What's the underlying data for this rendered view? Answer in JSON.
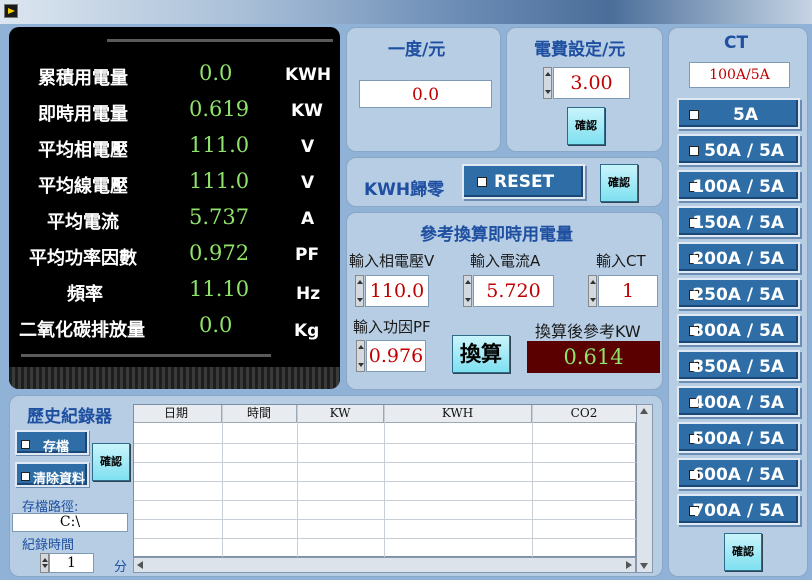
{
  "meter": {
    "rows": [
      {
        "label": "累積用電量",
        "value": "0.0",
        "unit": "KWH"
      },
      {
        "label": "即時用電量",
        "value": "0.619",
        "unit": "KW"
      },
      {
        "label": "平均相電壓",
        "value": "111.0",
        "unit": "V"
      },
      {
        "label": "平均線電壓",
        "value": "111.0",
        "unit": "V"
      },
      {
        "label": "平均電流",
        "value": "5.737",
        "unit": "A"
      },
      {
        "label": "平均功率因數",
        "value": "0.972",
        "unit": "PF"
      },
      {
        "label": "頻率",
        "value": "11.10",
        "unit": "Hz"
      },
      {
        "label": "二氧化碳排放量",
        "value": "0.0",
        "unit": "Kg"
      }
    ]
  },
  "cost": {
    "per_kwh_title": "一度/元",
    "per_kwh_value": "0.0",
    "setting_title": "電費設定/元",
    "setting_value": "3.00",
    "confirm_label": "確認"
  },
  "reset": {
    "title": "KWH歸零",
    "button_label": "RESET",
    "confirm_label": "確認"
  },
  "calc": {
    "title": "參考換算即時用電量",
    "voltage_label": "輸入相電壓V",
    "voltage_value": "110.0",
    "current_label": "輸入電流A",
    "current_value": "5.720",
    "ct_label": "輸入CT",
    "ct_value": "1",
    "pf_label": "輸入功因PF",
    "pf_value": "0.976",
    "calc_button": "換算",
    "result_label": "換算後參考KW",
    "result_value": "0.614"
  },
  "history": {
    "title": "歷史紀錄器",
    "save_label": "存檔",
    "clear_label": "清除資料",
    "confirm_label": "確認",
    "path_label": "存檔路徑:",
    "path_value": "C:\\",
    "interval_label": "紀錄時間",
    "interval_value": "1",
    "interval_unit": "分",
    "columns": [
      "日期",
      "時間",
      "KW",
      "KWH",
      "CO2"
    ]
  },
  "ct": {
    "title": "CT",
    "current_value": "100A/5A",
    "options": [
      "5A",
      "50A / 5A",
      "100A / 5A",
      "150A / 5A",
      "200A / 5A",
      "250A / 5A",
      "300A / 5A",
      "350A / 5A",
      "400A / 5A",
      "500A / 5A",
      "600A / 5A",
      "700A / 5A"
    ],
    "confirm_label": "確認"
  }
}
